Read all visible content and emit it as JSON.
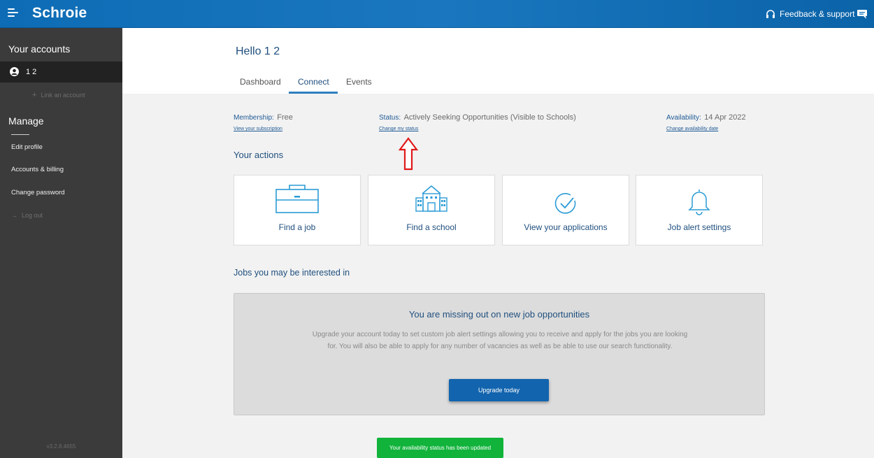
{
  "header": {
    "logo_text": "Schroie",
    "feedback_label": "Feedback & support",
    "brand_color": "#0d6cb5"
  },
  "sidebar": {
    "accounts_heading": "Your accounts",
    "account_name": "1 2",
    "link_account": "Link an account",
    "manage_heading": "Manage",
    "items": [
      {
        "label": "Edit profile"
      },
      {
        "label": "Accounts & billing"
      },
      {
        "label": "Change password"
      }
    ],
    "logout": "Log out",
    "version": "v3.2.8.4655"
  },
  "main": {
    "greeting": "Hello 1 2",
    "tabs": [
      {
        "label": "Dashboard",
        "active": false
      },
      {
        "label": "Connect",
        "active": true
      },
      {
        "label": "Events",
        "active": false
      }
    ],
    "membership_label": "Membership:",
    "membership_value": "Free",
    "membership_link": "View your subscription",
    "status_label": "Status:",
    "status_value": "Actively Seeking Opportunities (Visible to Schools)",
    "status_link": "Change my status",
    "availability_label": "Availability:",
    "availability_value": "14 Apr 2022",
    "availability_link": "Change availability date",
    "actions_heading": "Your actions",
    "actions": [
      {
        "label": "Find a job",
        "icon": "briefcase-icon"
      },
      {
        "label": "Find a school",
        "icon": "school-icon"
      },
      {
        "label": "View your applications",
        "icon": "checkmark-circle-icon"
      },
      {
        "label": "Job alert settings",
        "icon": "bell-icon"
      }
    ],
    "jobs_heading": "Jobs you may be interested in",
    "promo": {
      "title": "You are missing out on new job opportunities",
      "text": "Upgrade your account today to set custom job alert settings allowing you to receive and apply for the jobs you are looking for. You will also be able to apply for any number of vacancies as well as be able to use our search functionality.",
      "button": "Upgrade today"
    },
    "toast": "Your availability status has been updated"
  }
}
